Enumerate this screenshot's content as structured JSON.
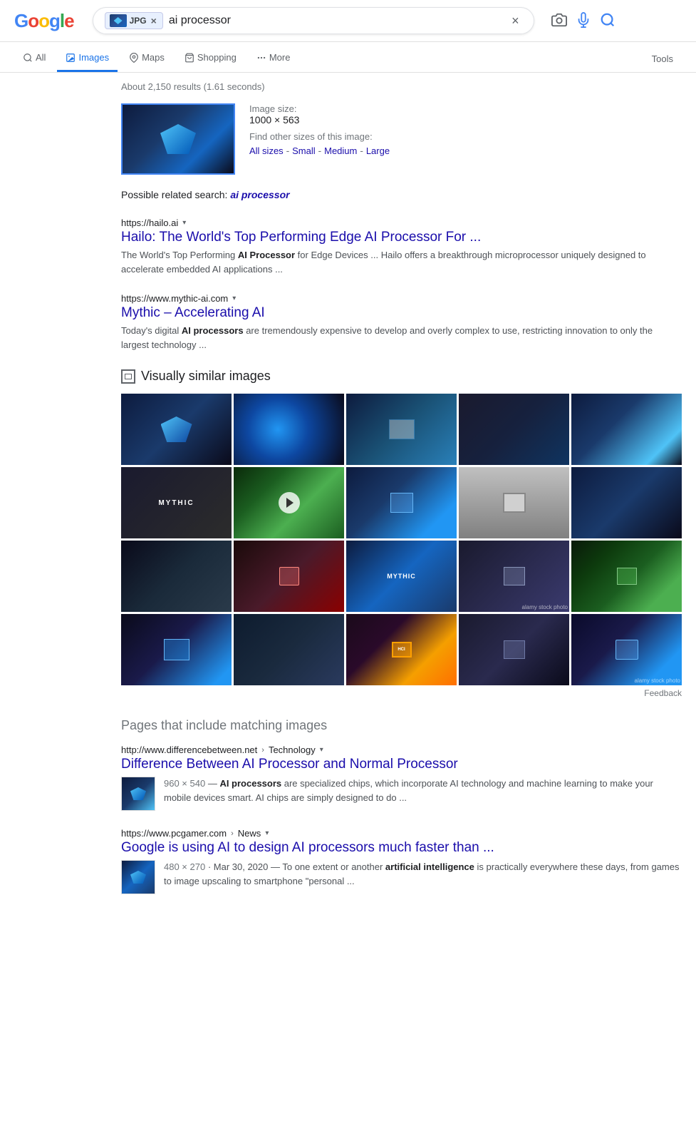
{
  "header": {
    "search_query": "ai processor",
    "jpg_label": "JPG"
  },
  "nav": {
    "items": [
      {
        "label": "All",
        "icon": "search",
        "active": false
      },
      {
        "label": "Images",
        "icon": "images",
        "active": true
      },
      {
        "label": "Maps",
        "icon": "map-pin",
        "active": false
      },
      {
        "label": "Shopping",
        "icon": "shopping-bag",
        "active": false
      },
      {
        "label": "More",
        "icon": "dots",
        "active": false
      }
    ],
    "tools_label": "Tools"
  },
  "results_info": "About 2,150 results (1.61 seconds)",
  "image_preview": {
    "size_label": "Image size:",
    "size_value": "1000 × 563",
    "find_label": "Find other sizes of this image:",
    "links": {
      "all": "All sizes",
      "small": "Small",
      "medium": "Medium",
      "large": "Large"
    }
  },
  "related_search": {
    "prefix": "Possible related search:",
    "query": "ai processor"
  },
  "search_results": [
    {
      "url": "https://hailo.ai",
      "url_display": "https://hailo.ai",
      "title": "Hailo: The World's Top Performing Edge AI Processor For ...",
      "snippet_parts": [
        "The World's Top Performing ",
        "AI Processor",
        " for Edge Devices ... Hailo offers a breakthrough microprocessor uniquely designed to accelerate embedded AI applications ..."
      ]
    },
    {
      "url": "https://www.mythic-ai.com",
      "url_display": "https://www.mythic-ai.com",
      "title": "Mythic – Accelerating AI",
      "snippet_parts": [
        "Today's digital ",
        "AI processors",
        " are tremendously expensive to develop and overly complex to use, restricting innovation to only the largest technology ..."
      ]
    }
  ],
  "similar_section": {
    "header": "Visually similar images"
  },
  "feedback_label": "Feedback",
  "pages_section": {
    "header": "Pages that include matching images",
    "results": [
      {
        "url_domain": "http://www.differencebetween.net",
        "url_path": "Technology",
        "title": "Difference Between AI Processor and Normal Processor",
        "dim": "960 × 540",
        "snippet_parts": [
          " — ",
          "AI processors",
          " are specialized chips, which incorporate AI technology and machine learning to make your mobile devices smart. AI chips are simply designed to do ..."
        ]
      },
      {
        "url_domain": "https://www.pcgamer.com",
        "url_path": "News",
        "title": "Google is using AI to design AI processors much faster than ...",
        "dim": "480 × 270",
        "date": "Mar 30, 2020",
        "snippet_parts": [
          " — To one extent or another ",
          "artificial intelligence",
          " is practically everywhere these days, from games to image upscaling to smartphone \"personal ..."
        ]
      }
    ]
  }
}
